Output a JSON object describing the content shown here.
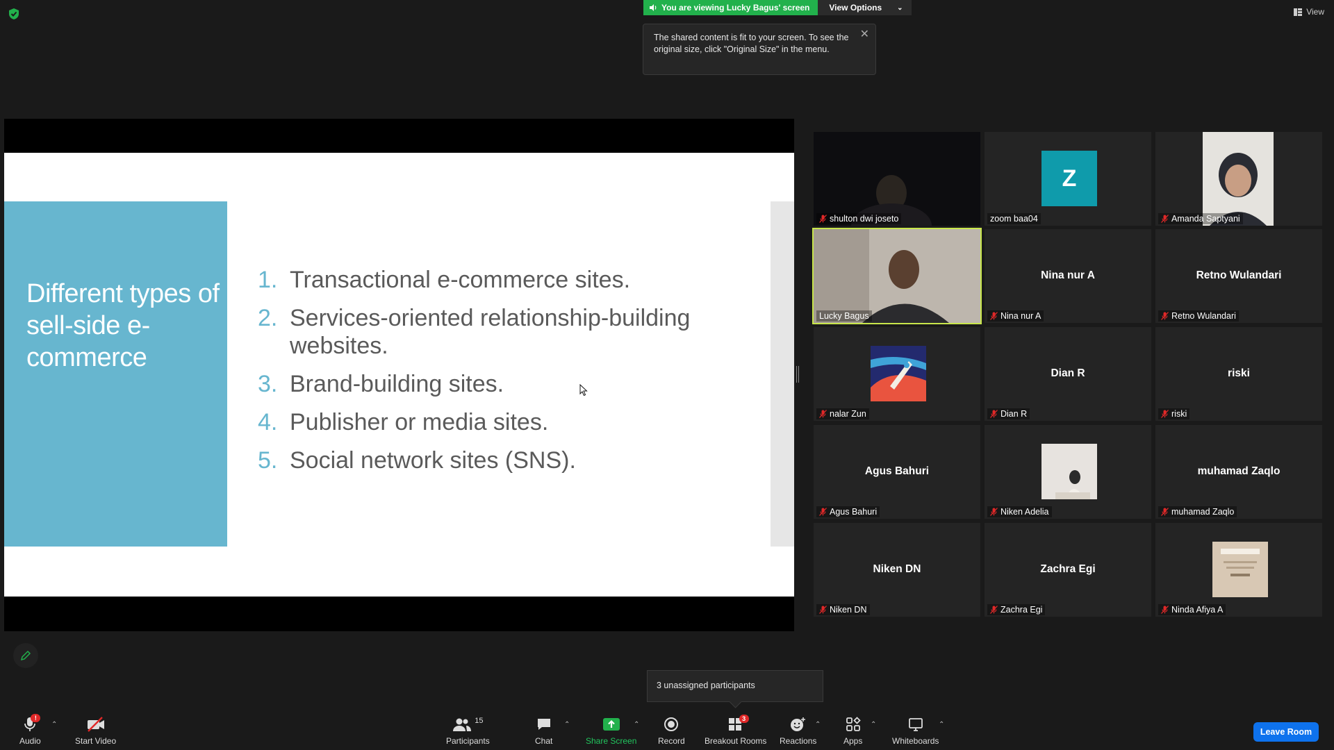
{
  "banner": {
    "viewing_text": "You are viewing Lucky Bagus' screen",
    "view_options": "View Options"
  },
  "tooltip": {
    "text": "The shared content is fit to your screen. To see the original size, click \"Original Size\" in the menu."
  },
  "top_right": {
    "view_label": "View"
  },
  "slide": {
    "title": "Different types of sell-side e-commerce",
    "items": [
      {
        "num": "1.",
        "text": "Transactional e-commerce sites."
      },
      {
        "num": "2.",
        "text": "Services-oriented relationship-building websites."
      },
      {
        "num": "3.",
        "text": "Brand-building sites."
      },
      {
        "num": "4.",
        "text": "Publisher or media sites."
      },
      {
        "num": "5.",
        "text": "Social network sites (SNS)."
      }
    ]
  },
  "gallery": {
    "tiles": [
      {
        "name": "shulton dwi joseto",
        "type": "video",
        "muted": true
      },
      {
        "name": "zoom baa04",
        "type": "avatar",
        "avatar_letter": "Z",
        "muted": false
      },
      {
        "name": "Amanda Saptyani",
        "type": "photo",
        "muted": true
      },
      {
        "name": "Lucky Bagus",
        "type": "video",
        "muted": false,
        "active": true
      },
      {
        "name": "Nina nur A",
        "type": "name",
        "muted": true
      },
      {
        "name": "Retno Wulandari",
        "type": "name",
        "muted": true
      },
      {
        "name": "nalar Zun",
        "type": "photo",
        "muted": true
      },
      {
        "name": "Dian R",
        "type": "name",
        "muted": true
      },
      {
        "name": "riski",
        "type": "name",
        "muted": true
      },
      {
        "name": "Agus Bahuri",
        "type": "name",
        "muted": true
      },
      {
        "name": "Niken Adelia",
        "type": "photo",
        "muted": true
      },
      {
        "name": "muhamad Zaqlo",
        "type": "name",
        "muted": true
      },
      {
        "name": "Niken DN",
        "type": "name",
        "muted": true
      },
      {
        "name": "Zachra Egi",
        "type": "name",
        "muted": true
      },
      {
        "name": "Ninda Afiya A",
        "type": "photo",
        "muted": true
      }
    ]
  },
  "unassigned": {
    "text": "3 unassigned participants"
  },
  "toolbar": {
    "audio": "Audio",
    "audio_badge": "!",
    "start_video": "Start Video",
    "participants": "Participants",
    "participants_count": "15",
    "chat": "Chat",
    "share_screen": "Share Screen",
    "record": "Record",
    "breakout_rooms": "Breakout Rooms",
    "breakout_badge": "3",
    "reactions": "Reactions",
    "apps": "Apps",
    "whiteboards": "Whiteboards",
    "leave_room": "Leave Room"
  },
  "colors": {
    "accent_green": "#22b14c",
    "active_speaker": "#c8e64b",
    "leave_blue": "#0e72ed",
    "slide_blue": "#67b6cf",
    "avatar_teal": "#0f9bab"
  }
}
